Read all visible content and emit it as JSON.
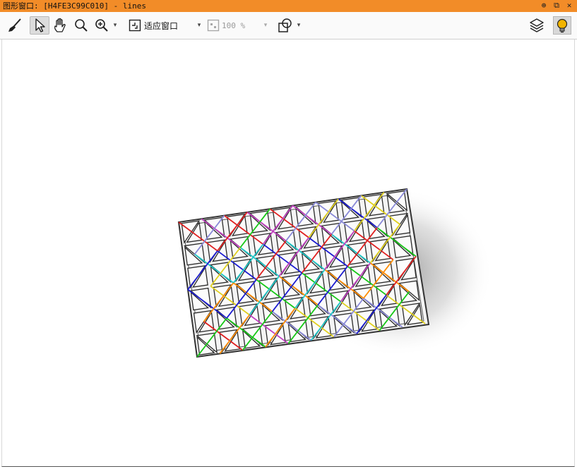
{
  "window": {
    "title": "图形窗口: [H4FE3C99C010] - lines",
    "pin_glyph": "⊕",
    "restore_glyph": "⧉",
    "close_glyph": "✕"
  },
  "toolbar": {
    "zoom_fit_label": "适应窗口",
    "zoom_percent_label": "100 %",
    "dropdown_glyph": "▾"
  },
  "canvas": {
    "image_description_colors": {
      "line_palette": [
        "#e02020",
        "#1d1dd0",
        "#18c818",
        "#e0d020",
        "#c040c0",
        "#20c8c8",
        "#ff8c00",
        "#8a8ad8"
      ]
    }
  },
  "colors": {
    "titlebar": "#f28c28",
    "toolbar": "#fafafa",
    "accent_lamp": "#f2b400"
  }
}
